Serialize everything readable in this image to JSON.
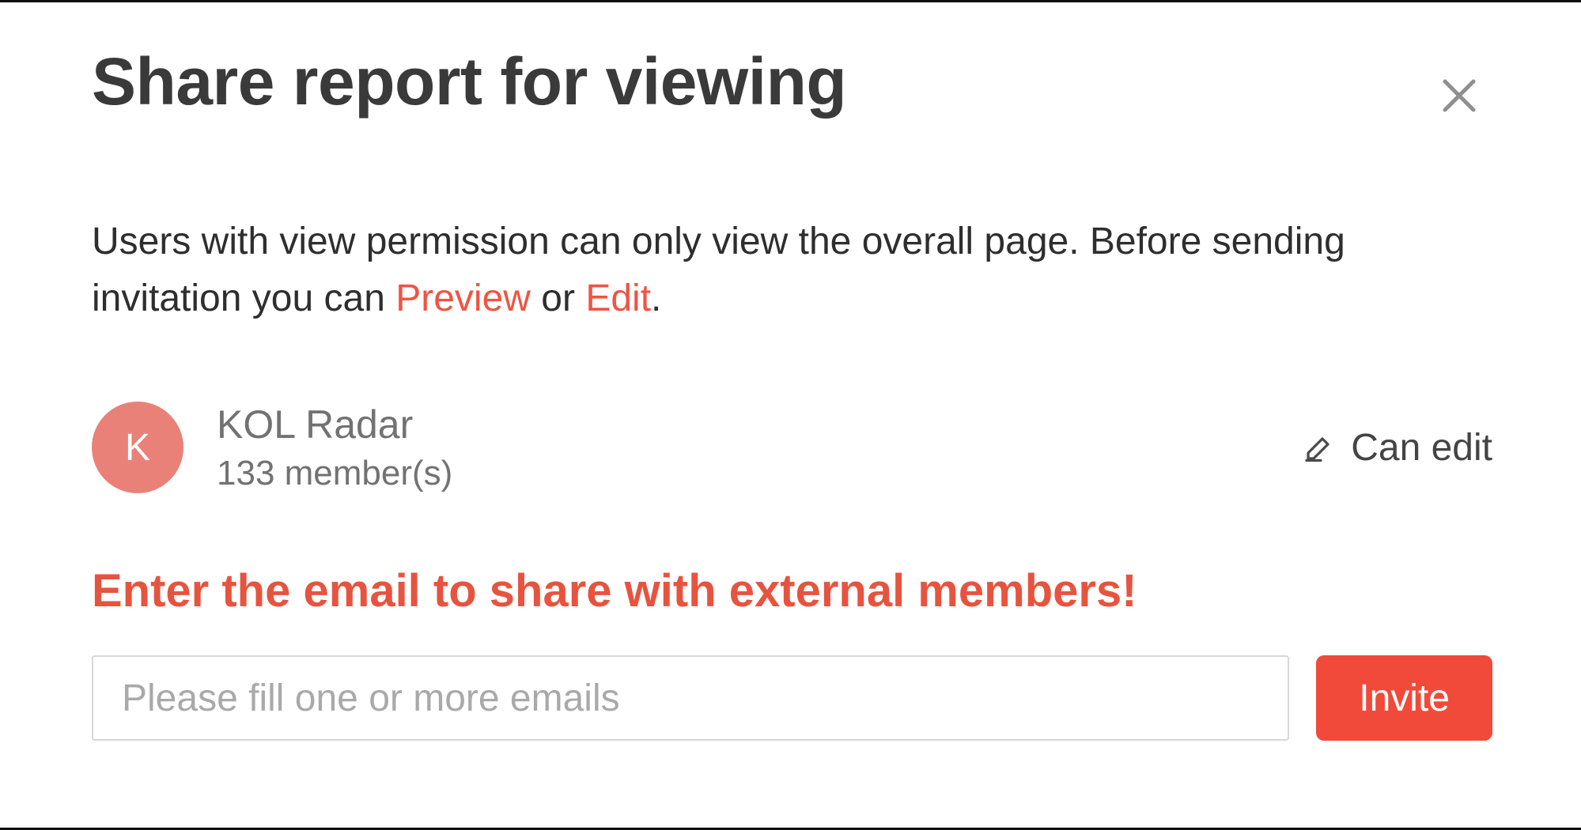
{
  "modal": {
    "title": "Share report for viewing",
    "description_prefix": "Users with view permission can only view the overall page. Before sending invitation you can ",
    "preview_label": "Preview",
    "or_word": " or ",
    "edit_label": "Edit",
    "description_suffix": "."
  },
  "team": {
    "avatar_letter": "K",
    "name": "KOL Radar",
    "member_count_text": "133 member(s)",
    "permission_label": "Can edit"
  },
  "instruction": "Enter the email to share with external members!",
  "input": {
    "placeholder": "Please fill one or more emails"
  },
  "buttons": {
    "invite": "Invite"
  },
  "colors": {
    "accent": "#f14a3a",
    "avatar": "#ea8178"
  }
}
